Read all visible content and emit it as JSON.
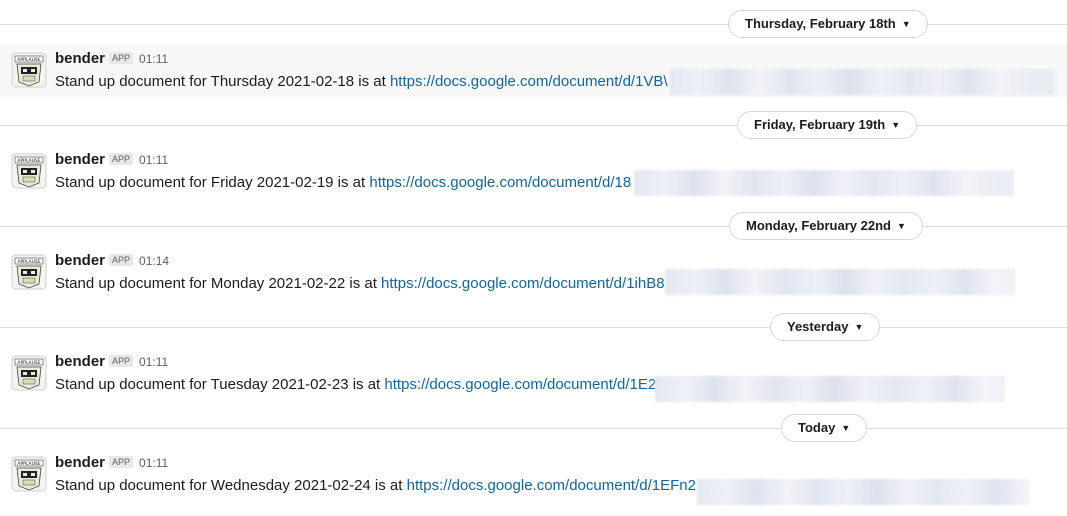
{
  "colors": {
    "link": "#1264a3",
    "divider_line": "#dddddd",
    "hover_row": "#f8f8f8",
    "badge_bg": "#e8e8e8"
  },
  "icons": {
    "avatar": "applause-badge-icon",
    "date_chevron": "chevron-down-icon"
  },
  "messages": [
    {
      "date": "Thursday, February 18th",
      "sender": "bender",
      "badge": "APP",
      "time": "01:11",
      "text": "Stand up document for Thursday 2021-02-18 is at ",
      "link": "https://docs.google.com/document/d/1VB\\"
    },
    {
      "date": "Friday, February 19th",
      "sender": "bender",
      "badge": "APP",
      "time": "01:11",
      "text": "Stand up document for Friday 2021-02-19 is at ",
      "link": "https://docs.google.com/document/d/18"
    },
    {
      "date": "Monday, February 22nd",
      "sender": "bender",
      "badge": "APP",
      "time": "01:14",
      "text": "Stand up document for Monday 2021-02-22 is at ",
      "link": "https://docs.google.com/document/d/1ihB8"
    },
    {
      "date": "Yesterday",
      "sender": "bender",
      "badge": "APP",
      "time": "01:11",
      "text": "Stand up document for Tuesday 2021-02-23 is at ",
      "link": "https://docs.google.com/document/d/1E2"
    },
    {
      "date": "Today",
      "sender": "bender",
      "badge": "APP",
      "time": "01:11",
      "text": "Stand up document for Wednesday 2021-02-24 is at ",
      "link": "https://docs.google.com/document/d/1EFn2"
    }
  ]
}
